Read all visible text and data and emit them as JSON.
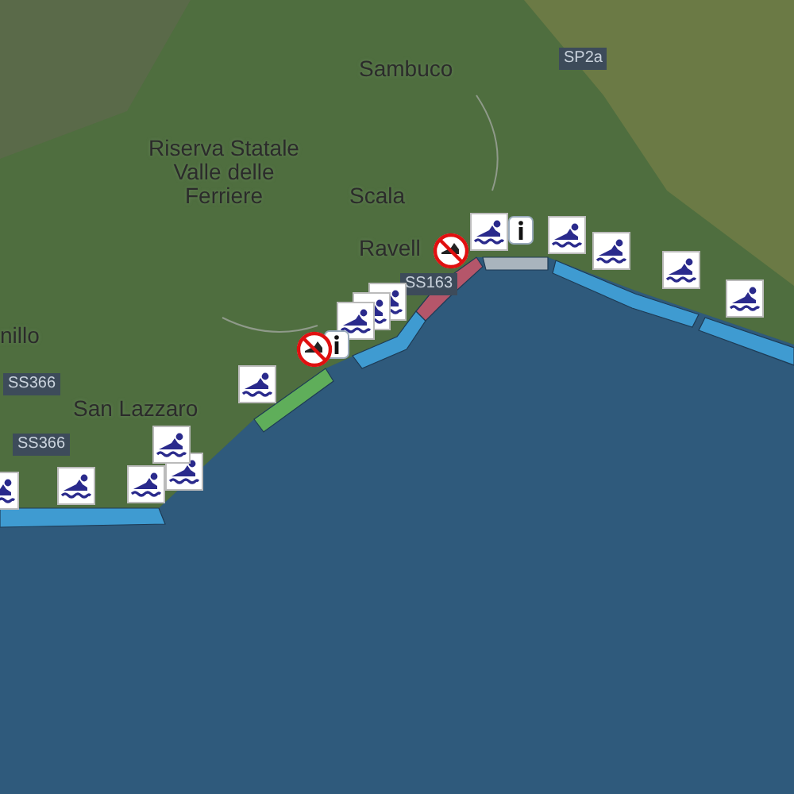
{
  "map": {
    "labels": [
      {
        "kind": "place",
        "text": "Sambuco"
      },
      {
        "kind": "place",
        "text": "Riserva Statale Valle delle Ferriere"
      },
      {
        "kind": "place",
        "text": "Scala"
      },
      {
        "kind": "place",
        "text": "Ravell"
      },
      {
        "kind": "place",
        "text": "nillo"
      },
      {
        "kind": "place",
        "text": "San Lazzaro"
      },
      {
        "kind": "road",
        "text": "SS366"
      },
      {
        "kind": "road",
        "text": "SS366"
      },
      {
        "kind": "road",
        "text": "SP2a"
      },
      {
        "kind": "road",
        "text": "SS163"
      }
    ],
    "zones": [
      {
        "color": "#3f9bd1"
      },
      {
        "color": "#5fae5a"
      },
      {
        "color": "#3f9bd1"
      },
      {
        "color": "#b5566a"
      },
      {
        "color": "#a9b4bd"
      },
      {
        "color": "#3f9bd1"
      },
      {
        "color": "#3f9bd1"
      }
    ],
    "markers": [
      {
        "kind": "swim"
      },
      {
        "kind": "swim"
      },
      {
        "kind": "swim"
      },
      {
        "kind": "swim"
      },
      {
        "kind": "swim"
      },
      {
        "kind": "swim"
      },
      {
        "kind": "swim"
      },
      {
        "kind": "swim"
      },
      {
        "kind": "swim"
      },
      {
        "kind": "swim"
      },
      {
        "kind": "swim"
      },
      {
        "kind": "swim"
      },
      {
        "kind": "swim"
      },
      {
        "kind": "swim"
      },
      {
        "kind": "info"
      },
      {
        "kind": "info"
      },
      {
        "kind": "no-swim"
      },
      {
        "kind": "no-swim"
      }
    ]
  }
}
